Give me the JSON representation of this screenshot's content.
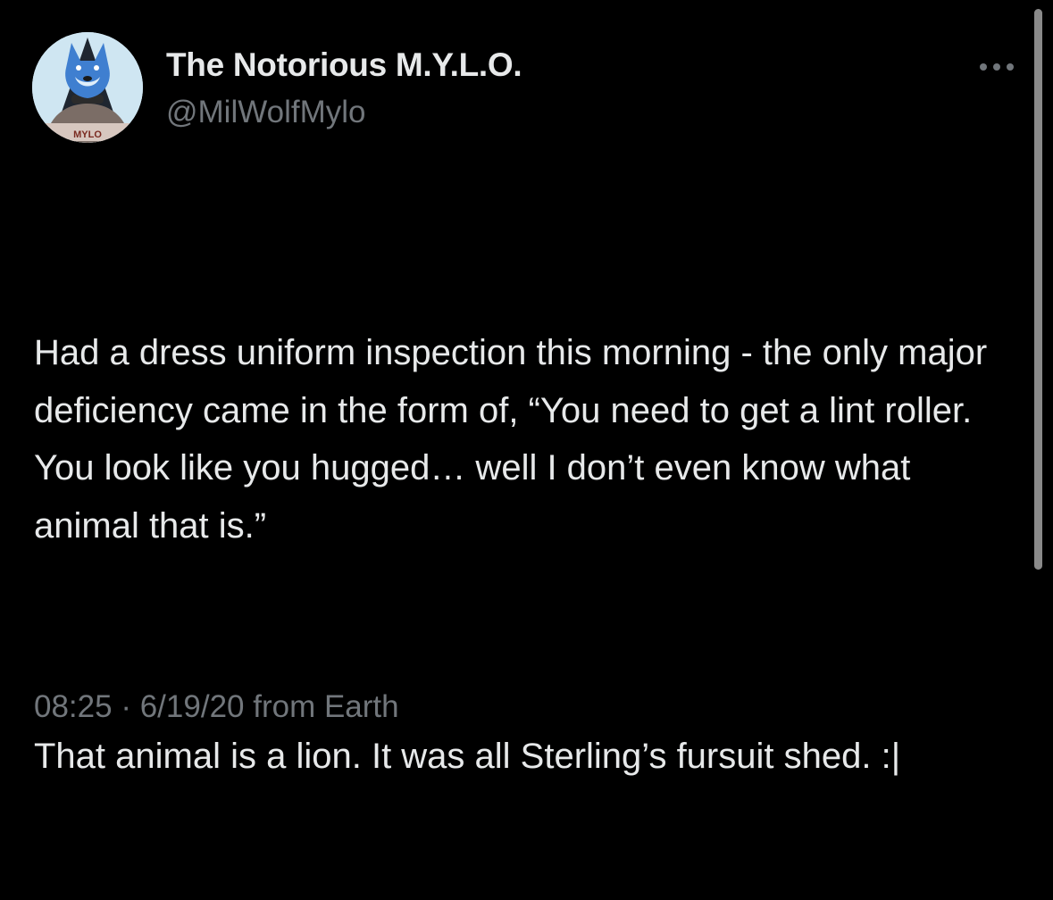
{
  "profile": {
    "display_name": "The Notorious M.Y.L.O.",
    "handle": "@MilWolfMylo",
    "avatar_icon": "wolf-avatar",
    "avatar_text": "MYLO"
  },
  "menu": {
    "more_icon": "ellipsis-icon"
  },
  "tweet": {
    "paragraphs": [
      "Had a dress uniform inspection this morning - the only major deficiency came in the form of, “You need to get a lint roller. You look like you hugged… well I don’t even know what animal that is.”",
      "That animal is a lion. It was all Sterling’s fursuit shed. :|"
    ],
    "time": "08:25",
    "separator": "·",
    "date": "6/19/20",
    "source": "from Earth"
  },
  "colors": {
    "background": "#000000",
    "primary_text": "#e7e9ea",
    "secondary_text": "#71767b"
  }
}
